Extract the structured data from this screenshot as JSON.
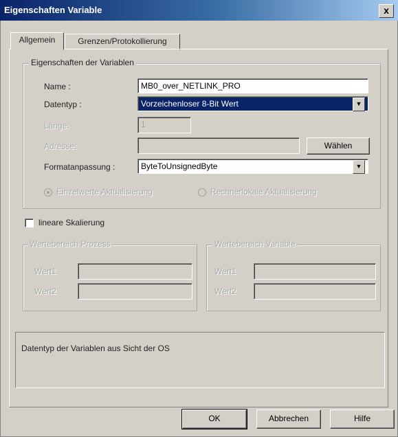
{
  "window": {
    "title": "Eigenschaften Variable",
    "close_label": "x"
  },
  "tabs": [
    {
      "label": "Allgemein"
    },
    {
      "label": "Grenzen/Protokollierung"
    }
  ],
  "properties_group": {
    "legend": "Eigenschaften der Variablen",
    "name_label": "Name :",
    "name_value": "MB0_over_NETLINK_PRO",
    "datatype_label": "Datentyp :",
    "datatype_value": "Vorzeichenloser 8-Bit Wert",
    "length_label": "Länge:",
    "length_value": "1",
    "address_label": "Adresse:",
    "address_value": "",
    "choose_button": "Wählen",
    "format_label": "Formatanpassung :",
    "format_value": "ByteToUnsignedByte",
    "radio1_label": "Einzelwerte Aktualisierung",
    "radio2_label": "Rechnerlokale Aktualisierung"
  },
  "linear_scaling": {
    "label": "lineare Skalierung"
  },
  "range_process": {
    "legend": "Wertebereich Prozess",
    "value1_label": "Wert1",
    "value2_label": "Wert2"
  },
  "range_variable": {
    "legend": "Wertebereich Variable",
    "value1_label": "Wert1",
    "value2_label": "Wert2"
  },
  "description": "Datentyp der Variablen aus Sicht der OS",
  "buttons": {
    "ok": "OK",
    "cancel": "Abbrechen",
    "help": "Hilfe"
  },
  "colors": {
    "title_bar": "#0a246a",
    "selected_field": "#0a246a",
    "dialog_face": "#d4d0c8"
  }
}
